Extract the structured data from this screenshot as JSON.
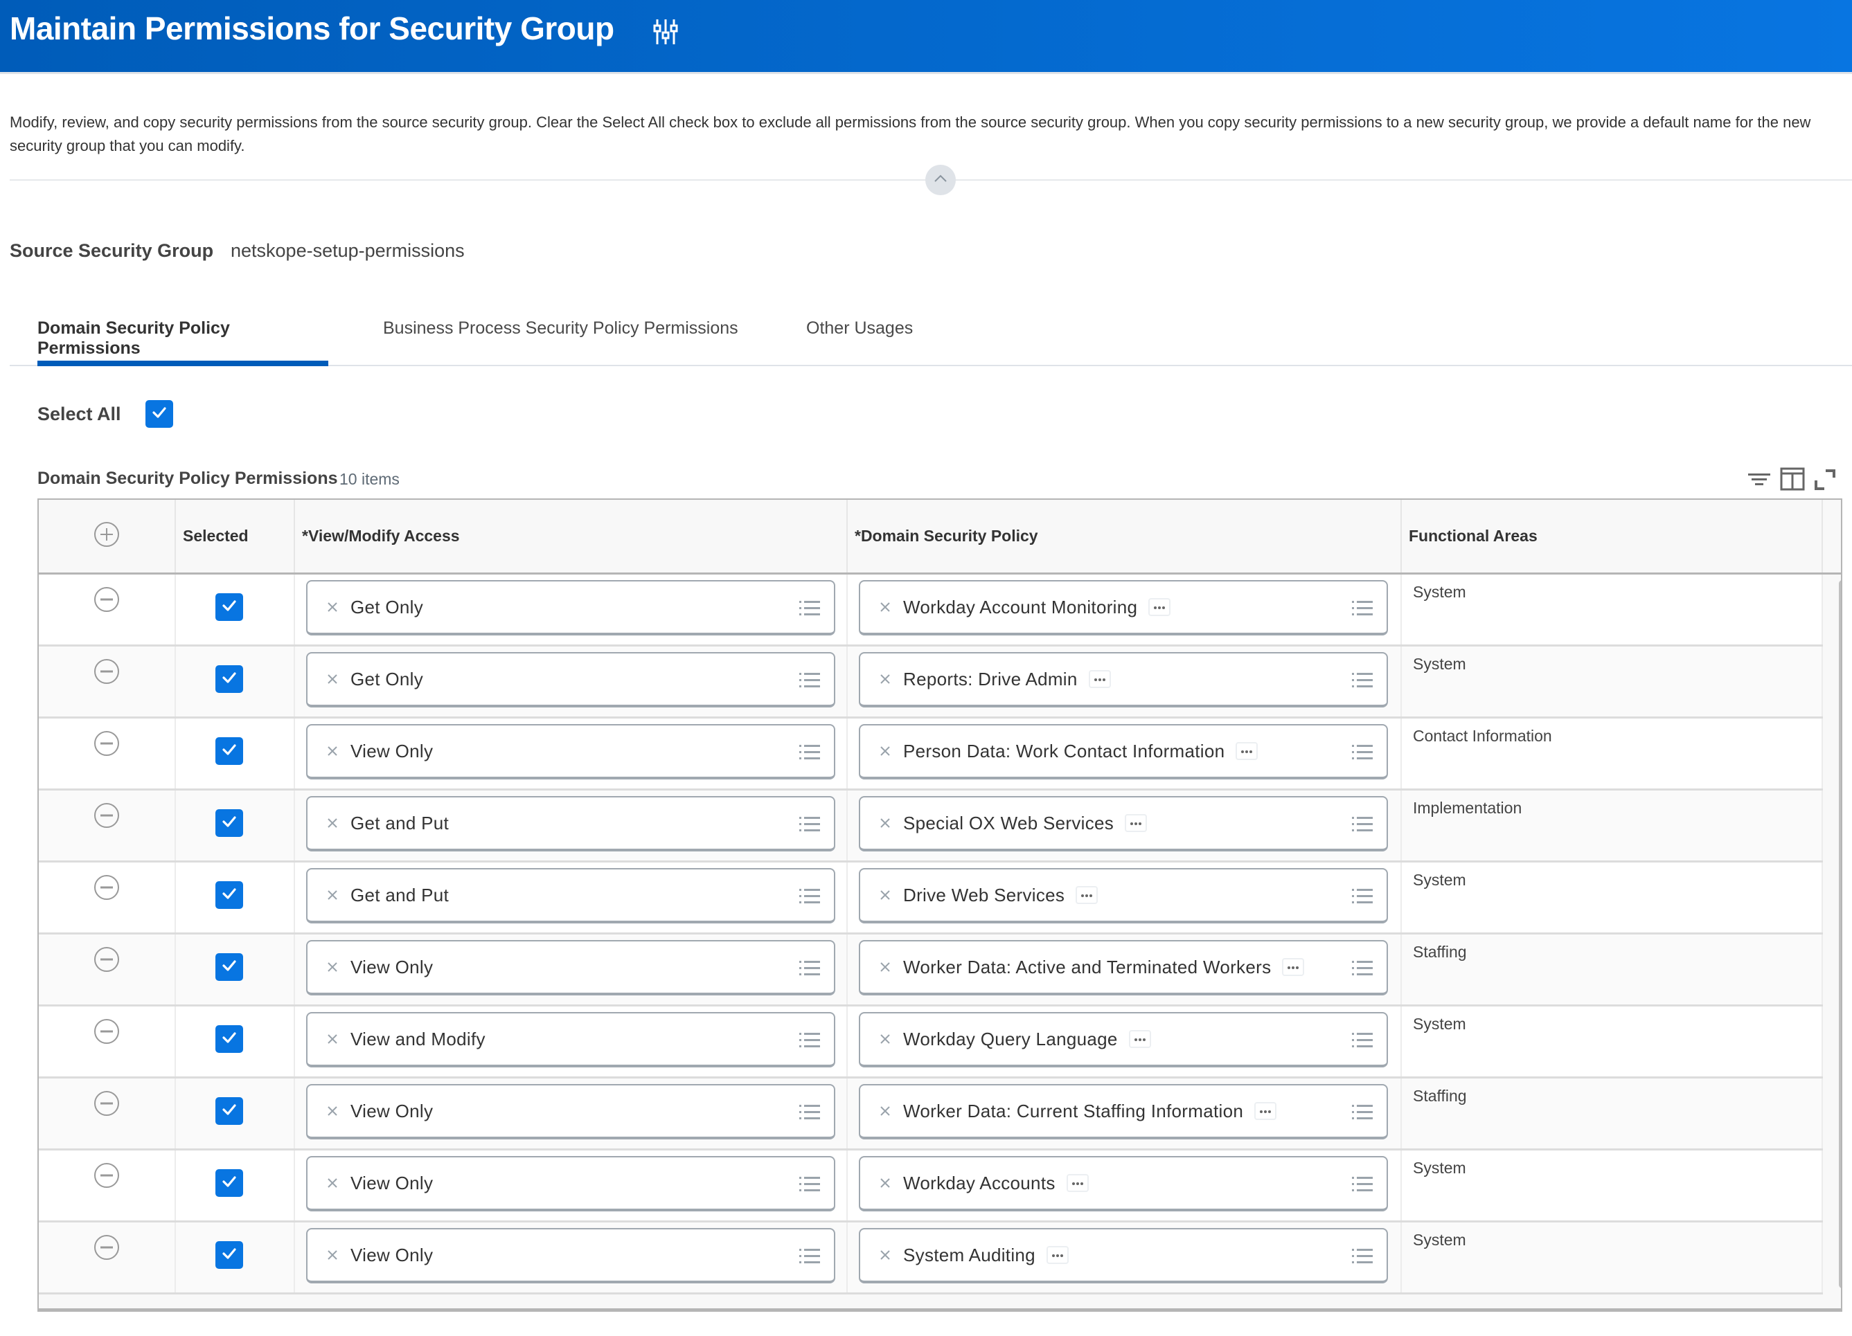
{
  "header": {
    "title": "Maintain Permissions for Security Group",
    "icon": "sliders-icon"
  },
  "description": "Modify, review, and copy security permissions from the source security group. Clear the Select All check box to exclude all permissions from the source security group. When you copy security permissions to a new security group, we provide a default name for the new security group that you can modify.",
  "source": {
    "label": "Source Security Group",
    "value": "netskope-setup-permissions"
  },
  "tabs": [
    {
      "label": "Domain Security Policy Permissions",
      "active": true
    },
    {
      "label": "Business Process Security Policy Permissions",
      "active": false
    },
    {
      "label": "Other Usages",
      "active": false
    }
  ],
  "select_all": {
    "label": "Select All",
    "checked": true
  },
  "grid": {
    "title": "Domain Security Policy Permissions",
    "count": "10 items",
    "tools": [
      "filter-icon",
      "column-layout-icon",
      "expand-icon"
    ],
    "columns": [
      "",
      "Selected",
      "*View/Modify Access",
      "*Domain Security Policy",
      "Functional Areas"
    ],
    "rows": [
      {
        "selected": true,
        "access": "Get Only",
        "policy": "Workday Account Monitoring",
        "area": "System"
      },
      {
        "selected": true,
        "access": "Get Only",
        "policy": "Reports: Drive Admin",
        "area": "System"
      },
      {
        "selected": true,
        "access": "View Only",
        "policy": "Person Data: Work Contact Information",
        "area": "Contact Information"
      },
      {
        "selected": true,
        "access": "Get and Put",
        "policy": "Special OX Web Services",
        "area": "Implementation"
      },
      {
        "selected": true,
        "access": "Get and Put",
        "policy": "Drive Web Services",
        "area": "System"
      },
      {
        "selected": true,
        "access": "View Only",
        "policy": "Worker Data: Active and Terminated Workers",
        "area": "Staffing"
      },
      {
        "selected": true,
        "access": "View and Modify",
        "policy": "Workday Query Language",
        "area": "System"
      },
      {
        "selected": true,
        "access": "View Only",
        "policy": "Worker Data: Current Staffing Information",
        "area": "Staffing"
      },
      {
        "selected": true,
        "access": "View Only",
        "policy": "Workday Accounts",
        "area": "System"
      },
      {
        "selected": true,
        "access": "View Only",
        "policy": "System Auditing",
        "area": "System"
      }
    ]
  },
  "colors": {
    "brand_blue": "#0875e1",
    "header_start": "#005cb9",
    "checkbox": "#0875e1",
    "tab_underline": "#005cb9"
  }
}
